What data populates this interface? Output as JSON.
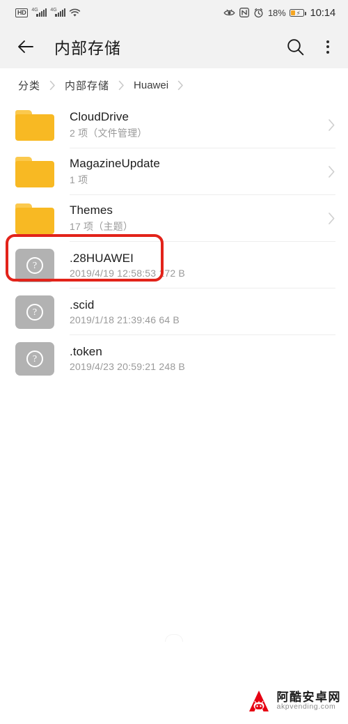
{
  "statusbar": {
    "hd_label": "HD",
    "network_1": "4G",
    "network_2": "4G",
    "wifi_icon": "wifi-icon",
    "eye_icon": "eye-comfort-icon",
    "nfc_icon": "N",
    "alarm_icon": "alarm-clock-icon",
    "battery_percent": "18%",
    "battery_icon": "battery-charging-icon",
    "time": "10:14"
  },
  "appbar": {
    "back_icon": "back-arrow-icon",
    "title": "内部存储",
    "search_icon": "search-icon",
    "menu_icon": "overflow-menu-icon"
  },
  "breadcrumb": {
    "items": [
      {
        "label": "分类"
      },
      {
        "label": "内部存储"
      },
      {
        "label": "Huawei"
      }
    ],
    "separator": "chevron-right-icon"
  },
  "file_list": [
    {
      "name": "CloudDrive",
      "meta": "2 项（文件管理）",
      "icon": "folder-icon",
      "type": "folder",
      "highlighted": false
    },
    {
      "name": "MagazineUpdate",
      "meta": "1 项",
      "icon": "folder-icon",
      "type": "folder",
      "highlighted": false
    },
    {
      "name": "Themes",
      "meta": "17 项（主题）",
      "icon": "folder-icon",
      "type": "folder",
      "highlighted": true
    },
    {
      "name": ".28HUAWEI",
      "meta": "2019/4/19 12:58:53 172 B",
      "icon": "unknown-file-icon",
      "type": "file",
      "highlighted": false
    },
    {
      "name": ".scid",
      "meta": "2019/1/18 21:39:46 64 B",
      "icon": "unknown-file-icon",
      "type": "file",
      "highlighted": false
    },
    {
      "name": ".token",
      "meta": "2019/4/23 20:59:21 248 B",
      "icon": "unknown-file-icon",
      "type": "file",
      "highlighted": false
    }
  ],
  "highlight": {
    "color": "#e2231a",
    "target": "Themes"
  },
  "watermark": {
    "site_cn": "阿酷安卓网",
    "site_url": "akpvending.com",
    "logo_icon": "android-a-logo",
    "logo_color": "#e60012"
  },
  "colors": {
    "folder": "#f8b923",
    "file_icon": "#b2b2b2",
    "chrome_bg": "#f2f2f2",
    "content_bg": "#ffffff",
    "title_text": "#1c1c1c",
    "meta_text": "#9a9a9a"
  }
}
